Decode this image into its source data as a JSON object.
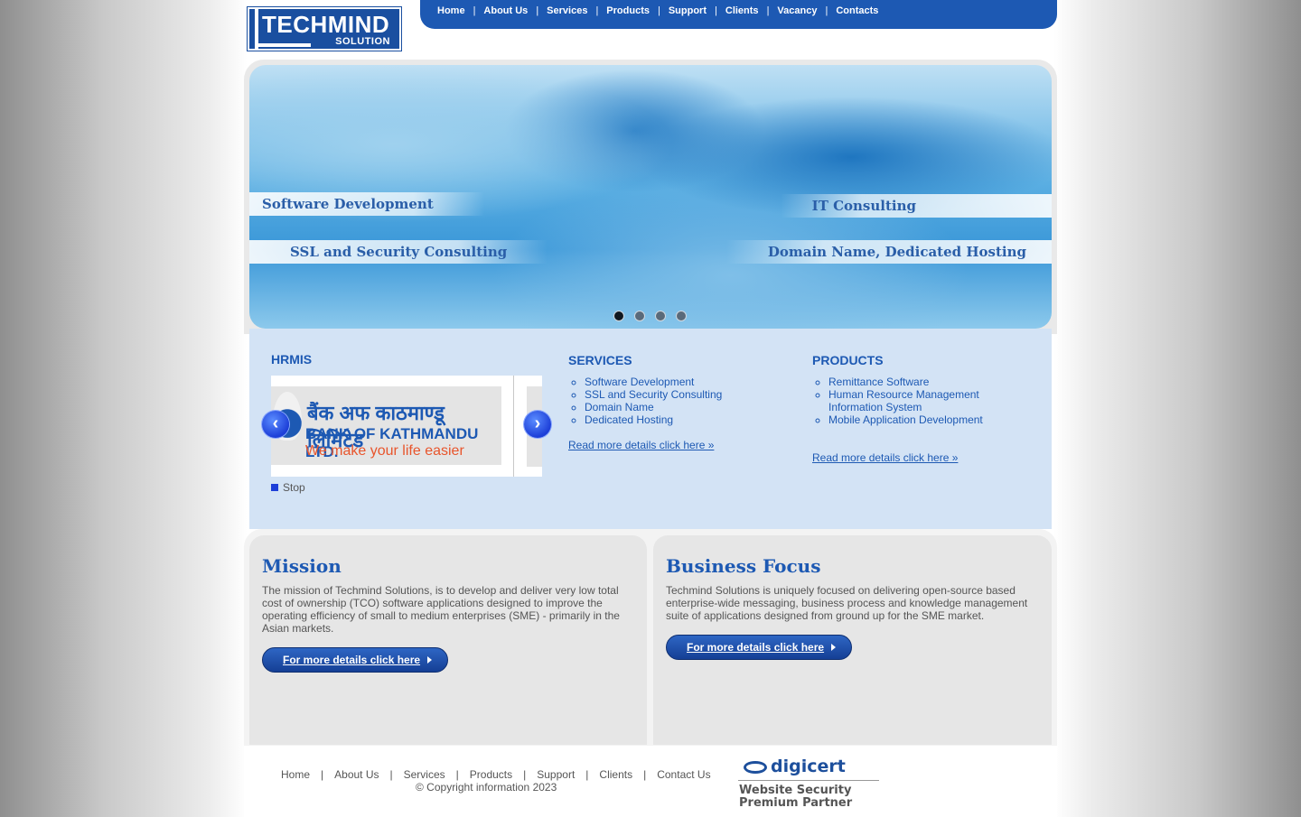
{
  "logo": {
    "main": "TECHMIND",
    "sub": "SOLUTION"
  },
  "topnav": [
    "Home",
    "About Us",
    "Services",
    "Products",
    "Support",
    "Clients",
    "Vacancy",
    "Contacts"
  ],
  "topnav_separator": "|",
  "banner": {
    "ribbons": [
      "Software Development",
      "IT Consulting",
      "SSL and Security Consulting",
      "Domain Name, Dedicated Hosting"
    ],
    "slide_count": 4,
    "active_slide": 1
  },
  "hrmis": {
    "title": "HRMIS",
    "slide": {
      "nepali": "बैंक अफ काठमाण्डू लिमिटेड",
      "english": "BANK OF KATHMANDU LTD.",
      "tagline": "We make your life easier"
    },
    "prev_icon": "chevron-left-icon",
    "next_icon": "chevron-right-icon",
    "stop_label": "Stop"
  },
  "services": {
    "title": "SERVICES",
    "items": [
      "Software Development",
      "SSL and Security Consulting",
      "Domain Name",
      "Dedicated Hosting"
    ],
    "read_more": "Read more details click here »"
  },
  "products": {
    "title": "PRODUCTS",
    "items": [
      "Remittance Software",
      "Human Resource Management Information System",
      "Mobile Application Development"
    ],
    "read_more": "Read more details click here »"
  },
  "mission": {
    "title": "Mission",
    "text": "The mission of Techmind Solutions, is to develop and deliver very low total cost of ownership (TCO) software applications designed to improve the operating efficiency of small to medium enterprises (SME) - primarily in the Asian markets.",
    "cta": "For more details click here"
  },
  "business_focus": {
    "title": "Business Focus",
    "text": "Techmind Solutions is uniquely focused on delivering open-source based enterprise-wide messaging, business process and knowledge management suite of applications designed from ground up for the SME market.",
    "cta": "For more details click here"
  },
  "footer": {
    "nav": [
      "Home",
      "About Us",
      "Services",
      "Products",
      "Support",
      "Clients",
      "Contact Us"
    ],
    "separator": "|",
    "copyright": "© Copyright information 2023",
    "badge": {
      "brand": "digicert",
      "line1": "Website Security",
      "line2": "Premium Partner"
    }
  },
  "colors": {
    "brand_blue": "#1d59b3",
    "info_bg": "#d3e3f5",
    "accent_orange": "#e8552c"
  }
}
